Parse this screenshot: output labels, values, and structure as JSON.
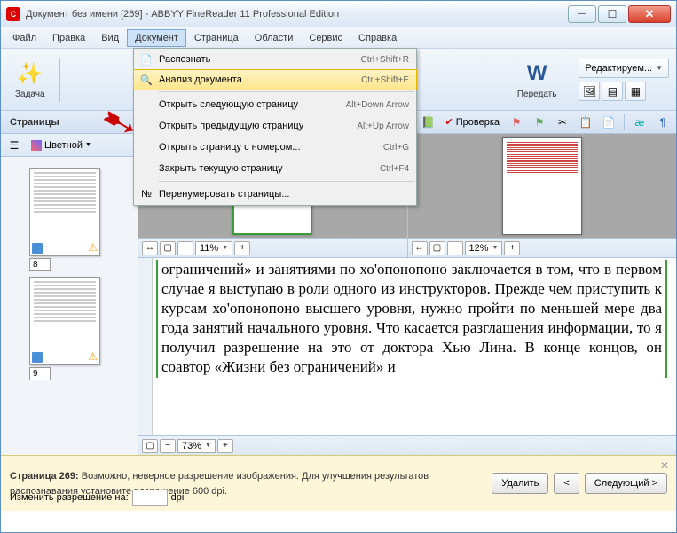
{
  "titlebar": {
    "app_icon": "C",
    "title": "Документ без имени [269] - ABBYY FineReader 11 Professional Edition"
  },
  "menu": {
    "file": "Файл",
    "edit": "Правка",
    "view": "Вид",
    "document": "Документ",
    "page": "Страница",
    "areas": "Области",
    "service": "Сервис",
    "help": "Справка"
  },
  "dropdown": {
    "recognize": {
      "label": "Распознать",
      "shortcut": "Ctrl+Shift+R"
    },
    "analyze": {
      "label": "Анализ документа",
      "shortcut": "Ctrl+Shift+E"
    },
    "next_page": {
      "label": "Открыть следующую страницу",
      "shortcut": "Alt+Down Arrow"
    },
    "prev_page": {
      "label": "Открыть предыдущую страницу",
      "shortcut": "Alt+Up Arrow"
    },
    "open_num": {
      "label": "Открыть страницу с номером...",
      "shortcut": "Ctrl+G"
    },
    "close_page": {
      "label": "Закрыть текущую страницу",
      "shortcut": "Ctrl+F4"
    },
    "renumber": {
      "label": "Перенумеровать страницы..."
    }
  },
  "toolbar": {
    "task": "Задача",
    "transfer": "Передать",
    "edit_mode": "Редактируем..."
  },
  "toolbar2": {
    "pages_title": "Страницы",
    "verify": "Проверка",
    "color": "Цветной"
  },
  "thumbs": {
    "p8": "8",
    "p9": "9"
  },
  "zoom": {
    "left": "11%",
    "right": "12%",
    "bottom": "73%"
  },
  "text": {
    "body": "ограничений» и занятиями по хо'опонопоно заключается в том, что в первом случае я выступаю в роли одного из инструкторов. Прежде чем приступить к курсам хо'опонопоно высшего уровня, нужно пройти по меньшей мере два года занятий начального уровня. Что касается разглашения информации, то я получил разрешение на это от доктора Хью Лина. В конце концов, он соавтор «Жизни без ограничений» и"
  },
  "status": {
    "page_label": "Страница 269:",
    "message": " Возможно, неверное разрешение изображения. Для улучшения результатов распознавания установите разрешение 600 dpi.",
    "delete": "Удалить",
    "prev": "<",
    "next": "Следующий >",
    "change_res": "Изменить разрешение на:",
    "dpi": "dpi"
  }
}
